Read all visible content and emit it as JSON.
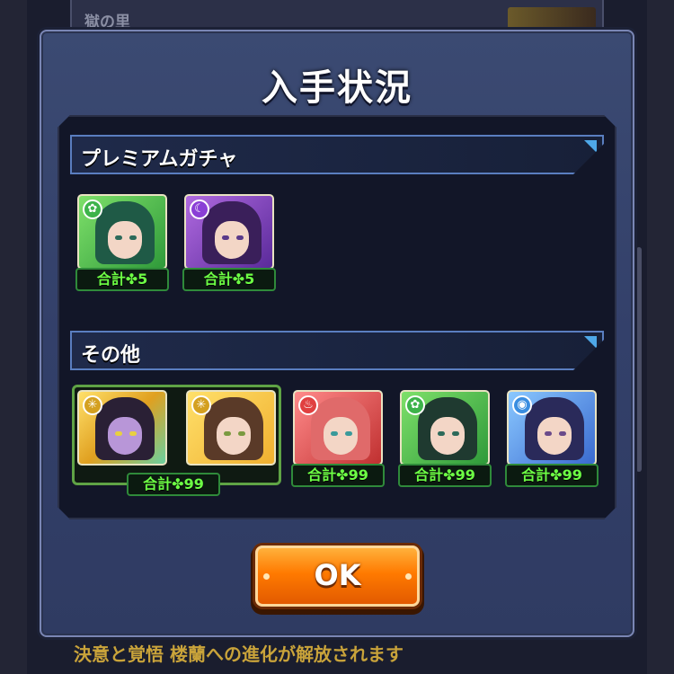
{
  "background": {
    "top_text": "獄の里",
    "bottom_text": "決意と覚悟 楼蘭への進化が解放されます"
  },
  "dialog": {
    "title": "入手状況",
    "sections": [
      {
        "label": "プレミアムガチャ",
        "items": [
          {
            "attribute": "wood",
            "attr_icon": "leaf-icon",
            "count": "合計✤5"
          },
          {
            "attribute": "dark",
            "attr_icon": "crescent-icon",
            "count": "合計✤5"
          }
        ]
      },
      {
        "label": "その他",
        "grouped_count": "合計✤99",
        "items": [
          {
            "attribute": "light",
            "attr_icon": "sun-icon",
            "count": ""
          },
          {
            "attribute": "light",
            "attr_icon": "sun-icon",
            "count": ""
          },
          {
            "attribute": "fire",
            "attr_icon": "flame-icon",
            "count": "合計✤99"
          },
          {
            "attribute": "wood",
            "attr_icon": "leaf-icon",
            "count": "合計✤99"
          },
          {
            "attribute": "water",
            "attr_icon": "drop-icon",
            "count": "合計✤99"
          }
        ]
      }
    ],
    "ok_label": "OK"
  },
  "colors": {
    "wood": "#3db34a",
    "dark": "#8a3fd6",
    "light": "#f3c53a",
    "fire": "#e04040",
    "water": "#3a8de0",
    "badge_text": "#6dff45",
    "ok_button": "#ff7a00"
  }
}
